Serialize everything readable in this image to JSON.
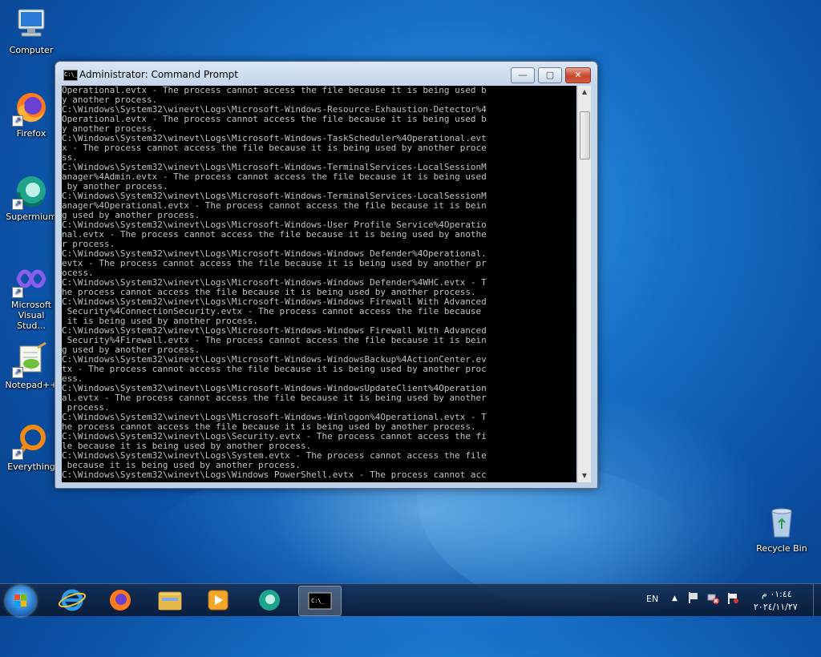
{
  "desktop": {
    "icons": [
      {
        "label": "Computer",
        "icon": "computer-icon"
      },
      {
        "label": "Firefox",
        "icon": "firefox-icon"
      },
      {
        "label": "Supermium",
        "icon": "supermium-icon"
      },
      {
        "label": "Microsoft Visual Stud...",
        "icon": "visual-studio-icon"
      },
      {
        "label": "Notepad++",
        "icon": "notepadpp-icon"
      },
      {
        "label": "Everything",
        "icon": "everything-icon"
      },
      {
        "label": "Recycle Bin",
        "icon": "recycle-bin-icon"
      }
    ]
  },
  "window": {
    "title": "Administrator:  Command Prompt",
    "icon_text": "C:\\_",
    "minimize": "—",
    "maximize": "▢",
    "close": "✕",
    "console_lines": [
      "Operational.evtx - The process cannot access the file because it is being used b",
      "y another process.",
      "C:\\Windows\\System32\\winevt\\Logs\\Microsoft-Windows-Resource-Exhaustion-Detector%4",
      "Operational.evtx - The process cannot access the file because it is being used b",
      "y another process.",
      "C:\\Windows\\System32\\winevt\\Logs\\Microsoft-Windows-TaskScheduler%4Operational.evt",
      "x - The process cannot access the file because it is being used by another proce",
      "ss.",
      "C:\\Windows\\System32\\winevt\\Logs\\Microsoft-Windows-TerminalServices-LocalSessionM",
      "anager%4Admin.evtx - The process cannot access the file because it is being used",
      " by another process.",
      "C:\\Windows\\System32\\winevt\\Logs\\Microsoft-Windows-TerminalServices-LocalSessionM",
      "anager%4Operational.evtx - The process cannot access the file because it is bein",
      "g used by another process.",
      "C:\\Windows\\System32\\winevt\\Logs\\Microsoft-Windows-User Profile Service%4Operatio",
      "nal.evtx - The process cannot access the file because it is being used by anothe",
      "r process.",
      "C:\\Windows\\System32\\winevt\\Logs\\Microsoft-Windows-Windows Defender%4Operational.",
      "evtx - The process cannot access the file because it is being used by another pr",
      "ocess.",
      "C:\\Windows\\System32\\winevt\\Logs\\Microsoft-Windows-Windows Defender%4WHC.evtx - T",
      "he process cannot access the file because it is being used by another process.",
      "C:\\Windows\\System32\\winevt\\Logs\\Microsoft-Windows-Windows Firewall With Advanced",
      " Security%4ConnectionSecurity.evtx - The process cannot access the file because",
      " it is being used by another process.",
      "C:\\Windows\\System32\\winevt\\Logs\\Microsoft-Windows-Windows Firewall With Advanced",
      " Security%4Firewall.evtx - The process cannot access the file because it is bein",
      "g used by another process.",
      "C:\\Windows\\System32\\winevt\\Logs\\Microsoft-Windows-WindowsBackup%4ActionCenter.ev",
      "tx - The process cannot access the file because it is being used by another proc",
      "ess.",
      "C:\\Windows\\System32\\winevt\\Logs\\Microsoft-Windows-WindowsUpdateClient%4Operation",
      "al.evtx - The process cannot access the file because it is being used by another",
      " process.",
      "C:\\Windows\\System32\\winevt\\Logs\\Microsoft-Windows-Winlogon%4Operational.evtx - T",
      "he process cannot access the file because it is being used by another process.",
      "C:\\Windows\\System32\\winevt\\Logs\\Security.evtx - The process cannot access the fi",
      "le because it is being used by another process.",
      "C:\\Windows\\System32\\winevt\\Logs\\System.evtx - The process cannot access the file",
      " because it is being used by another process.",
      "C:\\Windows\\System32\\winevt\\Logs\\Windows PowerShell.evtx - The process cannot acc"
    ]
  },
  "taskbar": {
    "pinned": [
      "start-button",
      "internet-explorer-icon",
      "firefox-icon",
      "explorer-icon",
      "media-player-icon",
      "supermium-icon",
      "command-prompt-icon"
    ],
    "active": "command-prompt-icon",
    "language": "EN",
    "time": "٠١:٤٤ م",
    "date": "٢٠٢٤/١١/٢٧"
  },
  "colors": {
    "console_bg": "#000000",
    "console_fg": "#c0c0c0",
    "close_button": "#c8452c"
  }
}
